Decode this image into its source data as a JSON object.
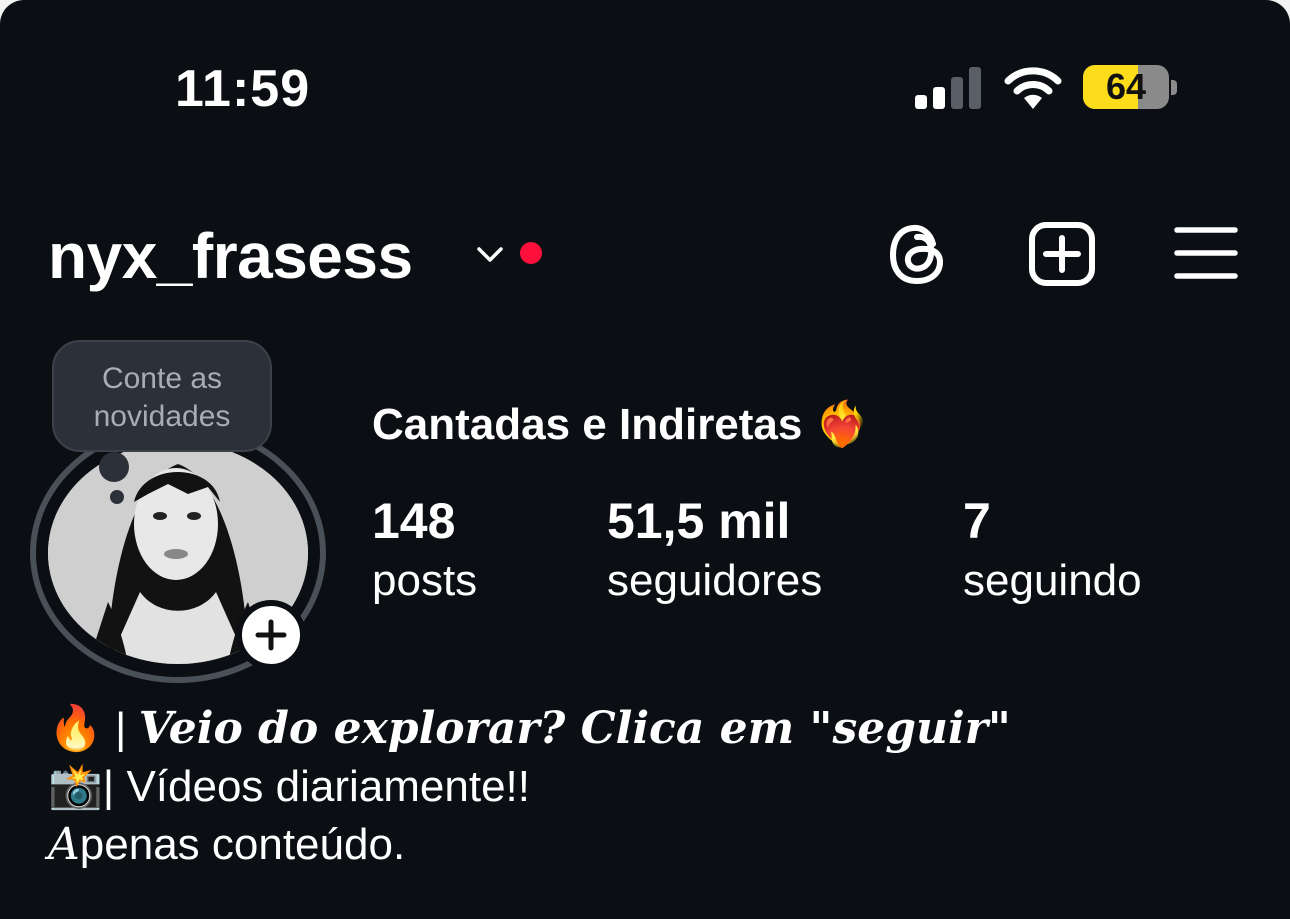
{
  "status_bar": {
    "time": "11:59",
    "battery_level": "64",
    "battery_percent": 64,
    "signal_bars_active": 2,
    "signal_bars_total": 4,
    "icons": [
      "signal-icon",
      "wifi-icon",
      "battery-icon"
    ]
  },
  "header": {
    "username": "nyx_frasess",
    "icons": [
      "chevron-down-icon",
      "notification-dot",
      "threads-icon",
      "create-post-icon",
      "menu-icon"
    ]
  },
  "note": {
    "line1": "Conte as",
    "line2": "novidades"
  },
  "profile": {
    "display_name": "Cantadas e Indiretas ❤️‍🔥",
    "stats": [
      {
        "value": "148",
        "label": "posts"
      },
      {
        "value": "51,5 mil",
        "label": "seguidores"
      },
      {
        "value": "7",
        "label": "seguindo"
      }
    ]
  },
  "bio": {
    "line1_prefix": "🔥 | ",
    "line1_text": "Veio do explorar? Clica em \"seguir\"",
    "line2": "📸| Vídeos diariamente!!",
    "line3_initial": "A",
    "line3_rest": "penas conteúdo."
  },
  "colors": {
    "background": "#0b0e13",
    "notification_dot": "#ff0f3a",
    "battery_fill": "#fddc1c"
  }
}
